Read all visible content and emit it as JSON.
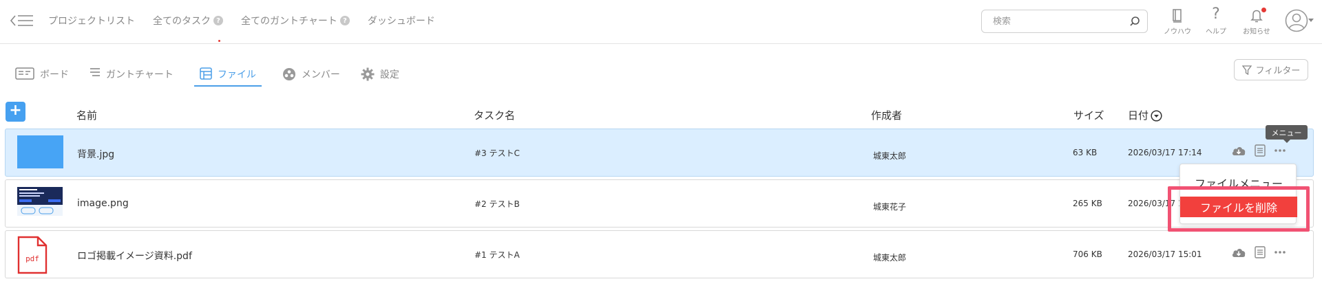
{
  "nav": {
    "links": [
      {
        "label": "プロジェクトリスト",
        "badge": ""
      },
      {
        "label": "全てのタスク",
        "badge": "?"
      },
      {
        "label": "全てのガントチャート",
        "badge": "?"
      },
      {
        "label": "ダッシュボード",
        "badge": ""
      }
    ],
    "search_placeholder": "検索",
    "knowhow_label": "ノウハウ",
    "help_label": "ヘルプ",
    "notice_label": "お知らせ"
  },
  "tabs": [
    {
      "label": "ボード",
      "icon": "board-icon"
    },
    {
      "label": "ガントチャート",
      "icon": "gantt-icon"
    },
    {
      "label": "ファイル",
      "icon": "file-icon",
      "active": true
    },
    {
      "label": "メンバー",
      "icon": "members-icon"
    },
    {
      "label": "設定",
      "icon": "gear-icon"
    }
  ],
  "filter_label": "フィルター",
  "table": {
    "headers": {
      "name": "名前",
      "task": "タスク名",
      "author": "作成者",
      "size": "サイズ",
      "date": "日付"
    },
    "rows": [
      {
        "name": "背景.jpg",
        "task": "#3 テストC",
        "author": "城東太郎",
        "size": "63 KB",
        "date": "2026/03/17 17:14",
        "thumb": "blue-image"
      },
      {
        "name": "image.png",
        "task": "#2 テストB",
        "author": "城東花子",
        "size": "265 KB",
        "date": "2026/03/17 1",
        "thumb": "screenshot"
      },
      {
        "name": "ロゴ掲載イメージ資料.pdf",
        "task": "#1 テストA",
        "author": "城東太郎",
        "size": "706 KB",
        "date": "2026/03/17 15:01",
        "thumb": "pdf"
      }
    ]
  },
  "tooltip": "メニュー",
  "dropdown": {
    "file_menu": "ファイルメニュー",
    "delete_file": "ファイルを削除"
  },
  "pdf_label": "pdf",
  "colors": {
    "accent": "#46a0f0",
    "danger": "#f2403d",
    "highlight": "#f15273",
    "selected_row": "#dbeeff"
  }
}
